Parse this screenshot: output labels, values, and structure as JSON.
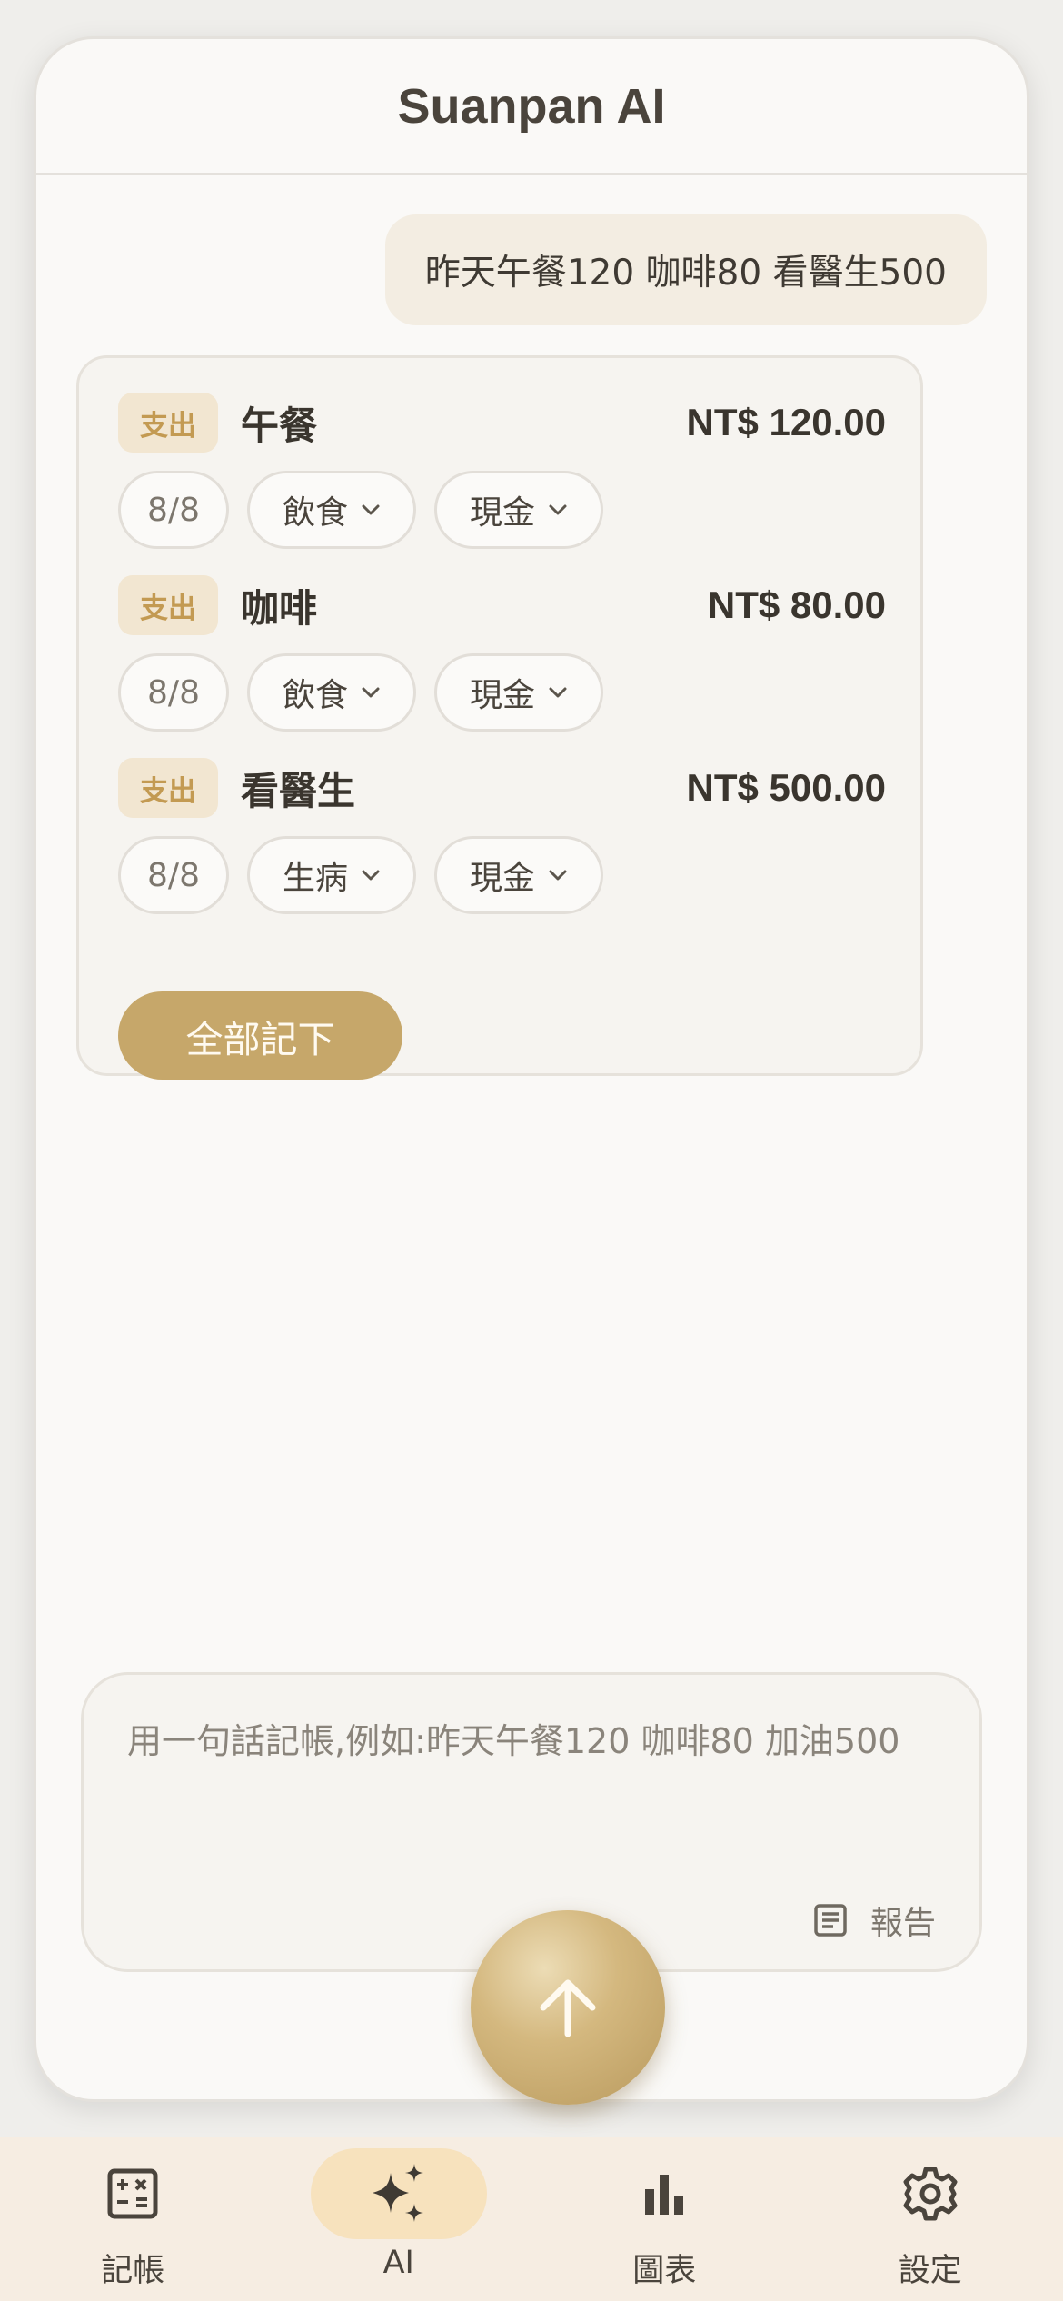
{
  "header": {
    "title": "Suanpan AI"
  },
  "chat": {
    "user_message": "昨天午餐120 咖啡80 看醫生500",
    "entries": [
      {
        "type": "支出",
        "name": "午餐",
        "amount": "NT$ 120.00",
        "date": "8/8",
        "category": "飲食",
        "account": "現金"
      },
      {
        "type": "支出",
        "name": "咖啡",
        "amount": "NT$ 80.00",
        "date": "8/8",
        "category": "飲食",
        "account": "現金"
      },
      {
        "type": "支出",
        "name": "看醫生",
        "amount": "NT$ 500.00",
        "date": "8/8",
        "category": "生病",
        "account": "現金"
      }
    ],
    "save_all_label": "全部記下"
  },
  "composer": {
    "placeholder": "用一句話記帳,例如:昨天午餐120 咖啡80 加油500",
    "report_label": "報告",
    "report_icon": "document-icon",
    "send_icon": "arrow-up-icon"
  },
  "tabs": [
    {
      "label": "記帳",
      "icon": "calculator-icon",
      "active": false
    },
    {
      "label": "AI",
      "icon": "sparkles-icon",
      "active": true
    },
    {
      "label": "圖表",
      "icon": "bar-chart-icon",
      "active": false
    },
    {
      "label": "設定",
      "icon": "gear-icon",
      "active": false
    }
  ],
  "colors": {
    "accent": "#c6a76a",
    "badge_bg": "#f2e6d1",
    "badge_text": "#c39a52",
    "active_tab_bg": "#f7e2bd",
    "tab_bar_bg": "#f6ede2"
  }
}
